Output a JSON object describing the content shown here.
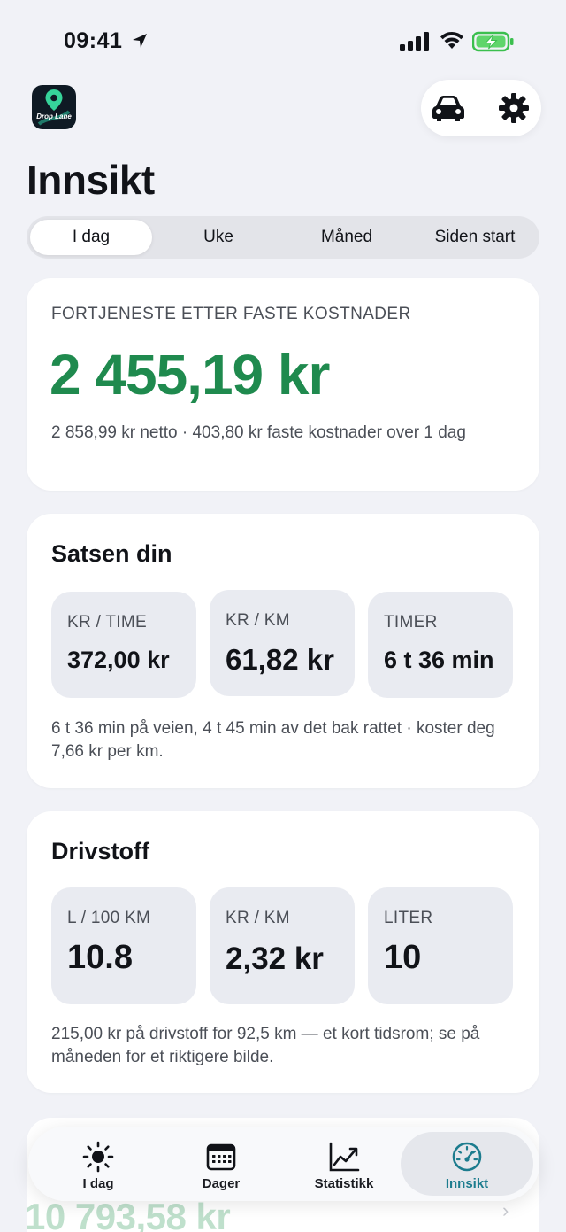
{
  "status_bar": {
    "time": "09:41"
  },
  "app": {
    "logo_text": "Drop Lane"
  },
  "page_title": "Innsikt",
  "periods": [
    "I dag",
    "Uke",
    "Måned",
    "Siden start"
  ],
  "profit": {
    "label": "FORTJENESTE ETTER FASTE KOSTNADER",
    "amount": "2 455,19 kr",
    "description": "2 858,99 kr netto · 403,80 kr faste kostnader over 1 dag",
    "color": "#1f8a4e"
  },
  "rate": {
    "title": "Satsen din",
    "tiles": [
      {
        "label": "KR / TIME",
        "value": "372,00 kr"
      },
      {
        "label": "KR / KM",
        "value": "61,82 kr"
      },
      {
        "label": "TIMER",
        "value": "6 t 36 min"
      }
    ],
    "note": "6 t 36 min på veien, 4 t 45 min av det bak rattet · koster deg 7,66 kr per km."
  },
  "fuel": {
    "title": "Drivstoff",
    "tiles": [
      {
        "label": "L / 100 KM",
        "value": "10.8"
      },
      {
        "label": "KR / KM",
        "value": "2,32 kr"
      },
      {
        "label": "LITER",
        "value": "10"
      }
    ],
    "note": "215,00 kr på drivstoff for 92,5 km — et kort tidsrom; se på måneden for et riktigere bilde."
  },
  "partial_card": {
    "amount": "10 793,58 kr"
  },
  "tabbar": {
    "tabs": [
      {
        "label": "I dag",
        "icon": "sun-icon"
      },
      {
        "label": "Dager",
        "icon": "calendar-icon"
      },
      {
        "label": "Statistikk",
        "icon": "chart-line-icon"
      },
      {
        "label": "Innsikt",
        "icon": "speedometer-icon"
      }
    ],
    "active": "Innsikt",
    "accent": "#1c7c8e"
  }
}
